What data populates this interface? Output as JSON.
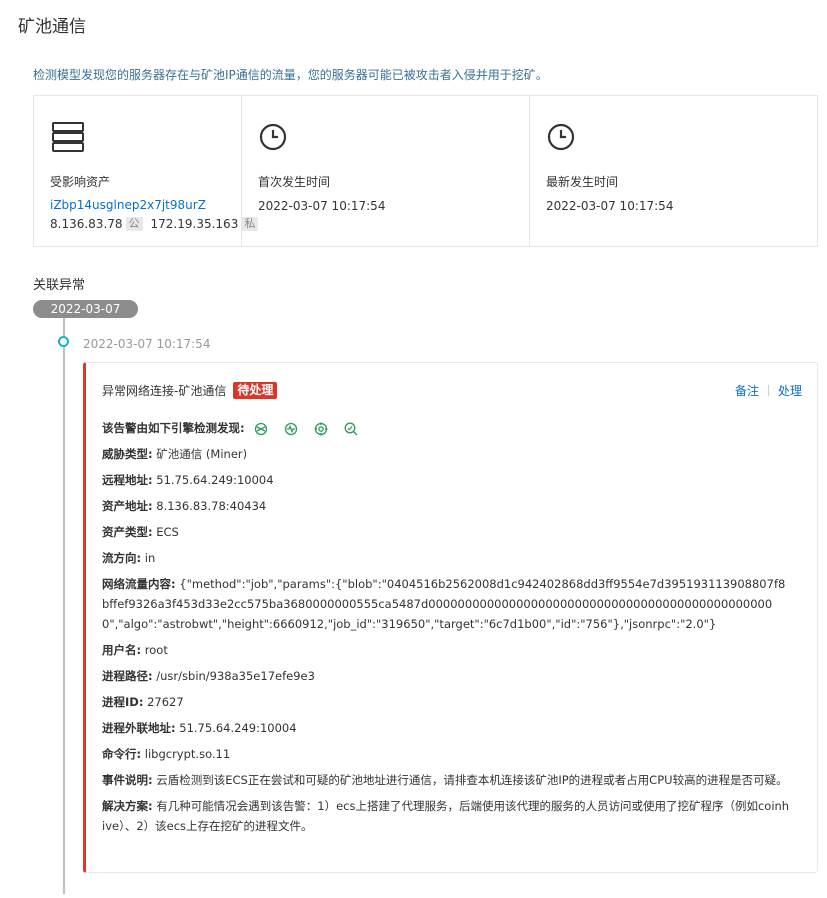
{
  "page": {
    "title": "矿池通信",
    "description": "检测模型发现您的服务器存在与矿池IP通信的流量，您的服务器可能已被攻击者入侵并用于挖矿。"
  },
  "summary": {
    "asset": {
      "icon": "server-icon",
      "label": "受影响资产",
      "instance_id": "iZbp14usglnep2x7jt98urZ",
      "public_ip": "8.136.83.78",
      "public_tag": "公",
      "private_ip": "172.19.35.163",
      "private_tag": "私"
    },
    "first_time": {
      "icon": "clock-icon",
      "label": "首次发生时间",
      "value": "2022-03-07 10:17:54"
    },
    "latest_time": {
      "icon": "clock-icon",
      "label": "最新发生时间",
      "value": "2022-03-07 10:17:54"
    }
  },
  "related": {
    "title": "关联异常",
    "date": "2022-03-07",
    "event_time": "2022-03-07 10:17:54"
  },
  "alert": {
    "title": "异常网络连接-矿池通信",
    "status": "待处理",
    "actions": {
      "note": "备注",
      "handle": "处理"
    },
    "engines_label": "该告警由如下引擎检测发现:",
    "engine_icons": [
      "engine-graph-icon",
      "engine-wave-icon",
      "engine-target-icon",
      "engine-search-icon"
    ],
    "fields": [
      {
        "key": "威胁类型:",
        "value": "矿池通信 (Miner)"
      },
      {
        "key": "远程地址:",
        "value": "51.75.64.249:10004"
      },
      {
        "key": "资产地址:",
        "value": "8.136.83.78:40434"
      },
      {
        "key": "资产类型:",
        "value": "ECS"
      },
      {
        "key": "流方向:",
        "value": "in"
      },
      {
        "key": "网络流量内容:",
        "value": "{\"method\":\"job\",\"params\":{\"blob\":\"0404516b2562008d1c942402868dd3ff9554e7d395193113908807f8bffef9326a3f453d33e2cc575ba3680000000555ca5487d000000000000000000000000000000000000000000000000\",\"algo\":\"astrobwt\",\"height\":6660912,\"job_id\":\"319650\",\"target\":\"6c7d1b00\",\"id\":\"756\"},\"jsonrpc\":\"2.0\"}"
      },
      {
        "key": "用户名:",
        "value": "root"
      },
      {
        "key": "进程路径:",
        "value": "/usr/sbin/938a35e17efe9e3"
      },
      {
        "key": "进程ID:",
        "value": "27627"
      },
      {
        "key": "进程外联地址:",
        "value": "51.75.64.249:10004"
      },
      {
        "key": "命令行:",
        "value": "libgcrypt.so.11"
      },
      {
        "key": "事件说明:",
        "value": "云盾检测到该ECS正在尝试和可疑的矿池地址进行通信，请排查本机连接该矿池IP的进程或者占用CPU较高的进程是否可疑。"
      },
      {
        "key": "解决方案:",
        "value": "有几种可能情况会遇到该告警：1）ecs上搭建了代理服务，后端使用该代理的服务的人员访问或使用了挖矿程序（例如coinhive）、2）该ecs上存在挖矿的进程文件。"
      }
    ]
  },
  "colors": {
    "accent_link": "#0a6ed1",
    "status_red": "#d9372a",
    "timeline_dot": "#1bb1c8",
    "description_text": "#3a6f94"
  }
}
